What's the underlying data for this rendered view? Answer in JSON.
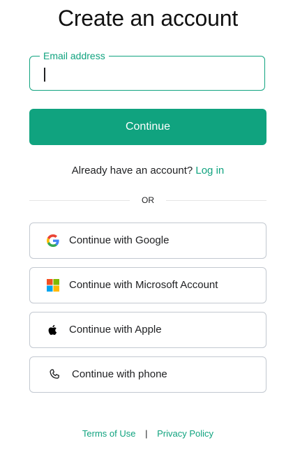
{
  "page": {
    "title": "Create an account"
  },
  "email": {
    "label": "Email address",
    "value": ""
  },
  "primary_action": {
    "label": "Continue",
    "color": "#10a37f"
  },
  "login_prompt": {
    "text": "Already have an account?",
    "link_label": "Log in"
  },
  "divider": {
    "label": "OR"
  },
  "social_buttons": [
    {
      "label": "Continue with Google",
      "icon": "google-icon"
    },
    {
      "label": "Continue with Microsoft Account",
      "icon": "microsoft-icon"
    },
    {
      "label": "Continue with Apple",
      "icon": "apple-icon"
    },
    {
      "label": "Continue with phone",
      "icon": "phone-icon"
    }
  ],
  "footer": {
    "terms_label": "Terms of Use",
    "separator": "|",
    "privacy_label": "Privacy Policy"
  }
}
